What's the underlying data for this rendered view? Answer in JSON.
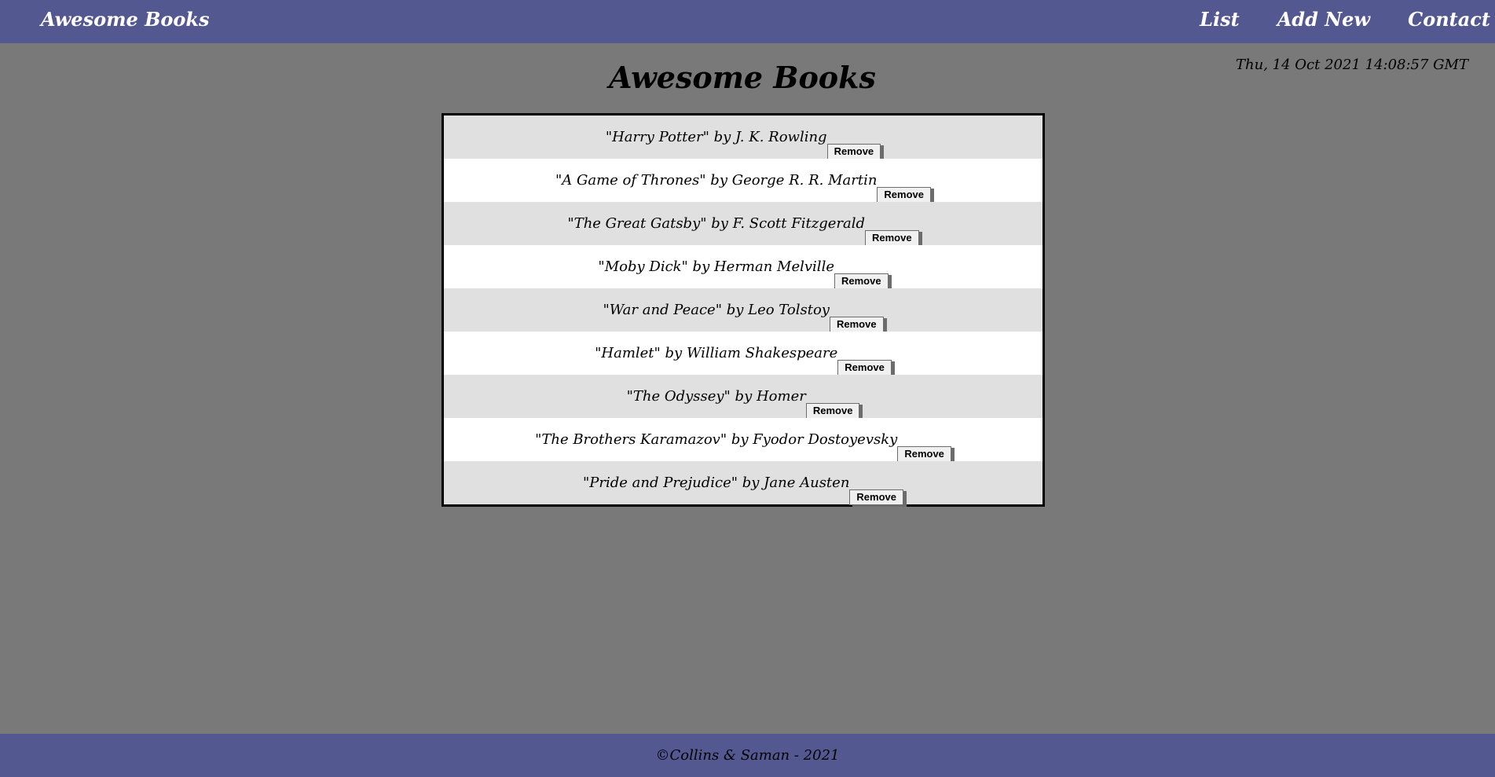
{
  "navbar": {
    "brand": "Awesome Books",
    "links": [
      "List",
      "Add New",
      "Contact"
    ]
  },
  "datetime": "Thu, 14 Oct 2021 14:08:57 GMT",
  "page_title": "Awesome Books",
  "books": [
    {
      "text": "\"Harry Potter\" by J. K. Rowling",
      "remove_label": "Remove"
    },
    {
      "text": "\"A Game of Thrones\" by George R. R. Martin",
      "remove_label": "Remove"
    },
    {
      "text": "\"The Great Gatsby\" by F. Scott Fitzgerald",
      "remove_label": "Remove"
    },
    {
      "text": "\"Moby Dick\" by Herman Melville",
      "remove_label": "Remove"
    },
    {
      "text": "\"War and Peace\" by Leo Tolstoy",
      "remove_label": "Remove"
    },
    {
      "text": "\"Hamlet\" by William Shakespeare",
      "remove_label": "Remove"
    },
    {
      "text": "\"The Odyssey\" by Homer",
      "remove_label": "Remove"
    },
    {
      "text": "\"The Brothers Karamazov\" by Fyodor Dostoyevsky",
      "remove_label": "Remove"
    },
    {
      "text": "\"Pride and Prejudice\" by Jane Austen",
      "remove_label": "Remove"
    }
  ],
  "footer": {
    "text": "©Collins & Saman - 2021"
  },
  "colors": {
    "navbar_bg": "#545891",
    "page_bg": "#797979",
    "row_odd": "#e0e0e0",
    "row_even": "#ffffff"
  }
}
